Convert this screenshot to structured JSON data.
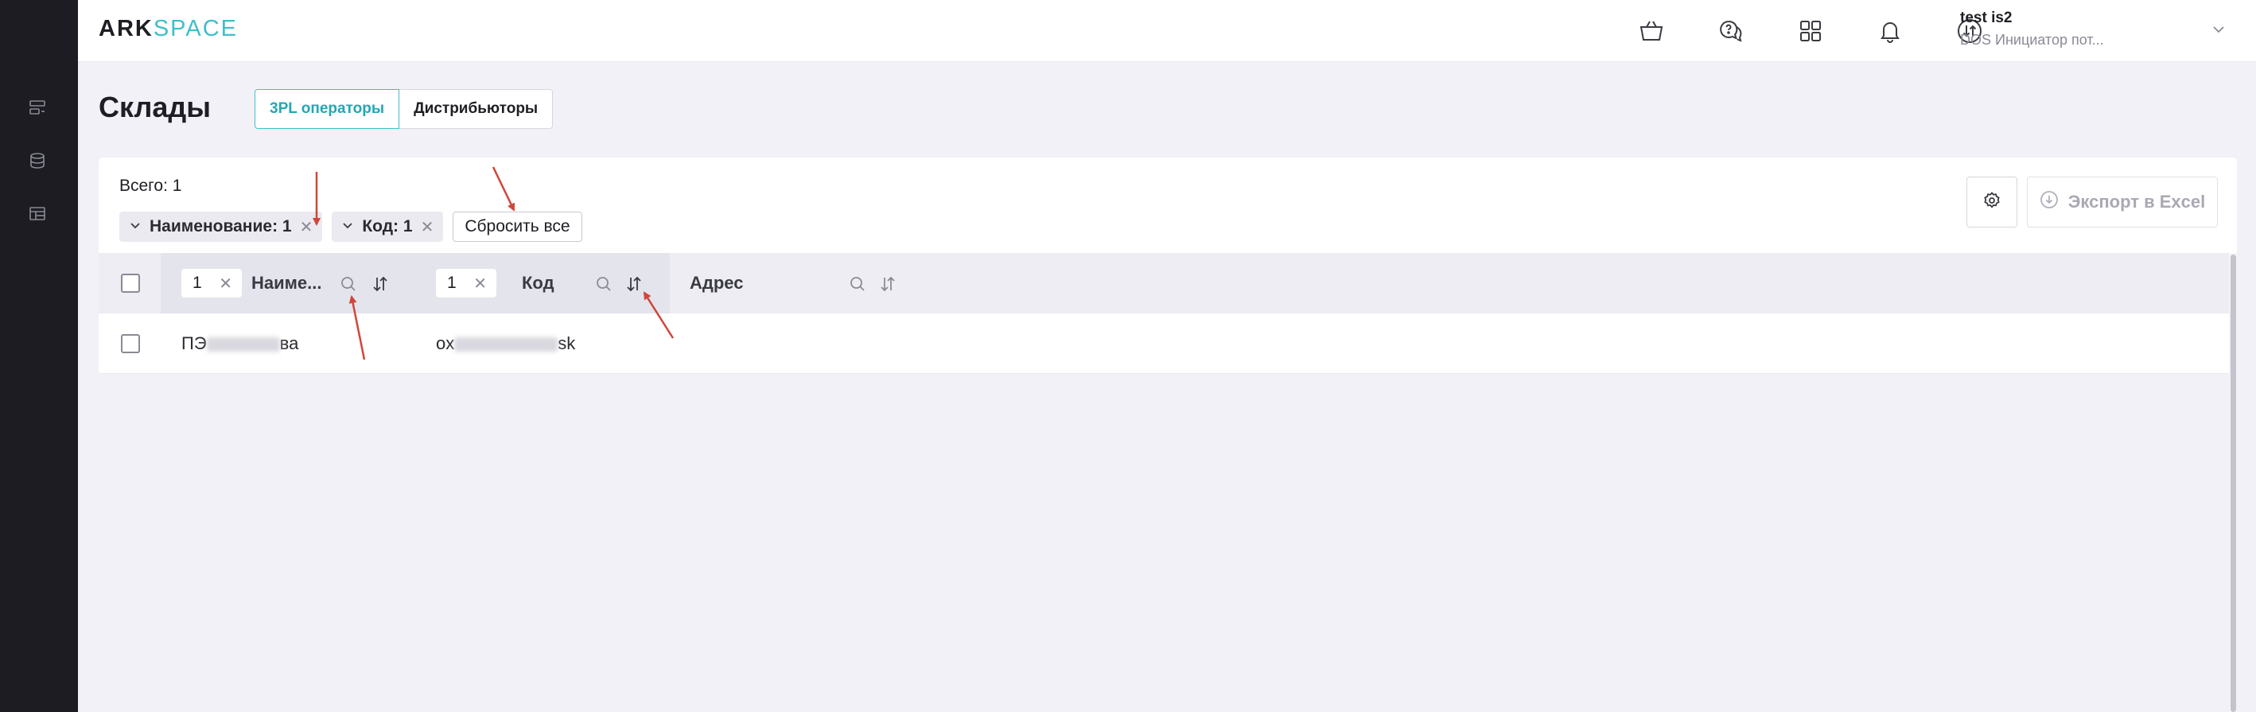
{
  "app": {
    "logo_ark": "ARK",
    "logo_space": "SPACE",
    "accent_color": "#3fbfca",
    "sidebar_bg": "#1c1c22"
  },
  "leftnav": {
    "items": [
      {
        "icon": "list-icon"
      },
      {
        "icon": "database-icon"
      },
      {
        "icon": "table-icon"
      }
    ]
  },
  "topbar": {
    "icons": [
      "basket-icon",
      "support-chat-icon",
      "apps-grid-icon",
      "bell-icon",
      "sync-icon"
    ],
    "user_name": "test is2",
    "user_role": "DOS Инициатор пот..."
  },
  "page": {
    "title": "Склады",
    "tabs": [
      {
        "label": "3PL операторы",
        "active": true
      },
      {
        "label": "Дистрибьюторы",
        "active": false
      }
    ]
  },
  "summary": {
    "total": "Всего: 1"
  },
  "filters": {
    "chips": [
      {
        "label": "Наименование: 1"
      },
      {
        "label": "Код: 1"
      }
    ],
    "reset_label": "Сбросить все"
  },
  "actions": {
    "export_label": "Экспорт в Excel"
  },
  "table": {
    "columns": [
      {
        "label": "Наиме...",
        "filter_value": "1"
      },
      {
        "label": "Код",
        "filter_value": "1"
      },
      {
        "label": "Адрес"
      }
    ],
    "rows": [
      {
        "name_start": "ПЭ",
        "name_end": "ва",
        "code_start": "ox",
        "code_end": "sk"
      }
    ]
  }
}
